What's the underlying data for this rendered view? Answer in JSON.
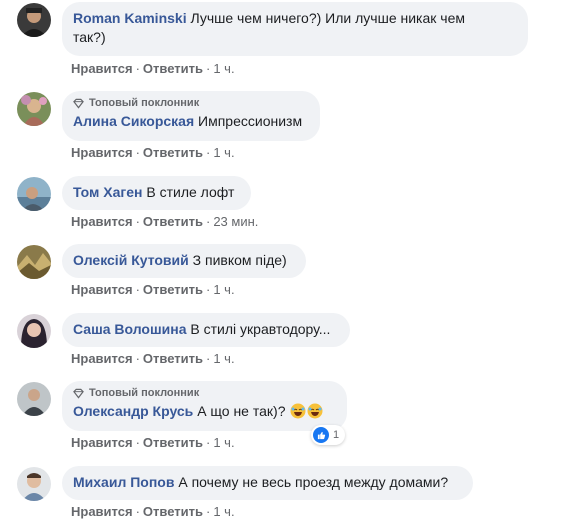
{
  "labels": {
    "like": "Нравится",
    "reply": "Ответить",
    "dot": "·"
  },
  "fan_badge": "Топовый поклонник",
  "colors": {
    "author": "#385898",
    "bubble": "#f0f2f5",
    "meta": "#65676b",
    "like_blue": "#1877f2"
  },
  "comments": [
    {
      "author": "Roman Kaminski",
      "text_line1": "Лучше чем ничего?) Или лучше никак чем",
      "text_line2": "так?)",
      "time": "1 ч."
    },
    {
      "author": "Алина Сикорская",
      "text": "Импрессионизм",
      "time": "1 ч.",
      "top_fan": true
    },
    {
      "author": "Том Хаген",
      "text": "В стиле лофт",
      "time": "23 мин."
    },
    {
      "author": "Олексій Кутовий",
      "text": "З пивком піде)",
      "time": "1 ч."
    },
    {
      "author": "Саша Волошина",
      "text": "В стилі укравтодору...",
      "time": "1 ч."
    },
    {
      "author": "Олександр Крусь",
      "text": "А що не так)?",
      "time": "1 ч.",
      "top_fan": true,
      "emoji": "laughing-emoji",
      "reaction_count": "1"
    },
    {
      "author": "Михаил Попов",
      "text": "А почему не весь проезд между домами?",
      "time": "1 ч."
    }
  ]
}
